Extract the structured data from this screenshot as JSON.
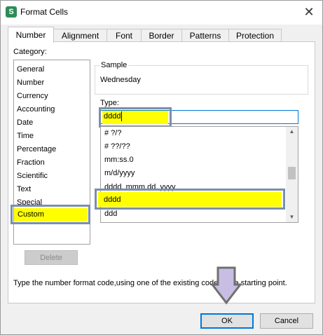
{
  "window": {
    "app_icon_letter": "S",
    "title": "Format Cells",
    "close_glyph": "✕"
  },
  "tabs": [
    {
      "label": "Number",
      "active": true
    },
    {
      "label": "Alignment"
    },
    {
      "label": "Font"
    },
    {
      "label": "Border"
    },
    {
      "label": "Patterns"
    },
    {
      "label": "Protection"
    }
  ],
  "category": {
    "label": "Category:",
    "items": [
      "General",
      "Number",
      "Currency",
      "Accounting",
      "Date",
      "Time",
      "Percentage",
      "Fraction",
      "Scientific",
      "Text",
      "Special",
      "Custom"
    ],
    "selected": "Custom",
    "delete_label": "Delete"
  },
  "sample": {
    "label": "Sample",
    "value": "Wednesday"
  },
  "type": {
    "label": "Type:",
    "value": "dddd",
    "formats": [
      "# ?/?",
      "# ??/??",
      "mm:ss.0",
      "m/d/yyyy",
      "dddd, mmm dd, yyyy",
      "dddd",
      "ddd"
    ],
    "selected": "dddd"
  },
  "description": "Type the number format code,using one of the existing codes as a starting point.",
  "buttons": {
    "ok": "OK",
    "cancel": "Cancel"
  },
  "colors": {
    "highlight": "#ffff00",
    "annotation_border": "#7a8fae",
    "arrow_fill": "#c8bde3",
    "focus_blue": "#0078d7"
  }
}
